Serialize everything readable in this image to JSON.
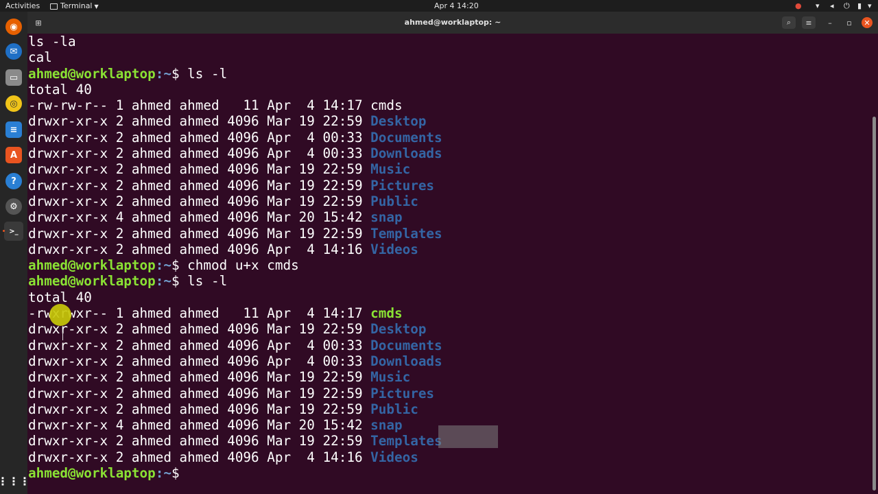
{
  "topbar": {
    "activities": "Activities",
    "app_label": "Terminal",
    "clock": "Apr 4  14:20"
  },
  "dock": {
    "icons": [
      "firefox-icon",
      "thunderbird-icon",
      "files-icon",
      "rhythmbox-icon",
      "writer-icon",
      "software-icon",
      "help-icon",
      "settings-icon",
      "terminal-icon"
    ],
    "apps_grid_icon": "apps-grid-icon"
  },
  "window": {
    "title": "ahmed@worklaptop: ~"
  },
  "prompt": {
    "user_host": "ahmed@worklaptop",
    "path": ":~",
    "symbol": "$"
  },
  "terminal": {
    "lines": [
      {
        "text": "ls -la"
      },
      {
        "text": "cal"
      },
      {
        "prompt": true,
        "cmd": " ls -l"
      },
      {
        "text": "total 40"
      },
      {
        "text": "-rw-rw-r-- 1 ahmed ahmed   11 Apr  4 14:17 ",
        "name": "cmds",
        "kind": "file"
      },
      {
        "text": "drwxr-xr-x 2 ahmed ahmed 4096 Mar 19 22:59 ",
        "name": "Desktop",
        "kind": "dir"
      },
      {
        "text": "drwxr-xr-x 2 ahmed ahmed 4096 Apr  4 00:33 ",
        "name": "Documents",
        "kind": "dir"
      },
      {
        "text": "drwxr-xr-x 2 ahmed ahmed 4096 Apr  4 00:33 ",
        "name": "Downloads",
        "kind": "dir"
      },
      {
        "text": "drwxr-xr-x 2 ahmed ahmed 4096 Mar 19 22:59 ",
        "name": "Music",
        "kind": "dir"
      },
      {
        "text": "drwxr-xr-x 2 ahmed ahmed 4096 Mar 19 22:59 ",
        "name": "Pictures",
        "kind": "dir"
      },
      {
        "text": "drwxr-xr-x 2 ahmed ahmed 4096 Mar 19 22:59 ",
        "name": "Public",
        "kind": "dir"
      },
      {
        "text": "drwxr-xr-x 4 ahmed ahmed 4096 Mar 20 15:42 ",
        "name": "snap",
        "kind": "dir"
      },
      {
        "text": "drwxr-xr-x 2 ahmed ahmed 4096 Mar 19 22:59 ",
        "name": "Templates",
        "kind": "dir"
      },
      {
        "text": "drwxr-xr-x 2 ahmed ahmed 4096 Apr  4 14:16 ",
        "name": "Videos",
        "kind": "dir"
      },
      {
        "prompt": true,
        "cmd": " chmod u+x cmds"
      },
      {
        "prompt": true,
        "cmd": " ls -l"
      },
      {
        "text": "total 40"
      },
      {
        "text": "-rwxrwxr-- 1 ahmed ahmed   11 Apr  4 14:17 ",
        "name": "cmds",
        "kind": "exec"
      },
      {
        "text": "drwxr-xr-x 2 ahmed ahmed 4096 Mar 19 22:59 ",
        "name": "Desktop",
        "kind": "dir"
      },
      {
        "text": "drwxr-xr-x 2 ahmed ahmed 4096 Apr  4 00:33 ",
        "name": "Documents",
        "kind": "dir"
      },
      {
        "text": "drwxr-xr-x 2 ahmed ahmed 4096 Apr  4 00:33 ",
        "name": "Downloads",
        "kind": "dir"
      },
      {
        "text": "drwxr-xr-x 2 ahmed ahmed 4096 Mar 19 22:59 ",
        "name": "Music",
        "kind": "dir"
      },
      {
        "text": "drwxr-xr-x 2 ahmed ahmed 4096 Mar 19 22:59 ",
        "name": "Pictures",
        "kind": "dir"
      },
      {
        "text": "drwxr-xr-x 2 ahmed ahmed 4096 Mar 19 22:59 ",
        "name": "Public",
        "kind": "dir"
      },
      {
        "text": "drwxr-xr-x 4 ahmed ahmed 4096 Mar 20 15:42 ",
        "name": "snap",
        "kind": "dir"
      },
      {
        "text": "drwxr-xr-x 2 ahmed ahmed 4096 Mar 19 22:59 ",
        "name": "Templates",
        "kind": "dir"
      },
      {
        "text": "drwxr-xr-x 2 ahmed ahmed 4096 Apr  4 14:16 ",
        "name": "Videos",
        "kind": "dir"
      },
      {
        "prompt": true,
        "cmd": " "
      }
    ]
  },
  "colors": {
    "background": "#300a24",
    "prompt_user": "#8ae234",
    "prompt_path": "#729fcf",
    "directory": "#3465a4",
    "executable": "#8ae234"
  }
}
